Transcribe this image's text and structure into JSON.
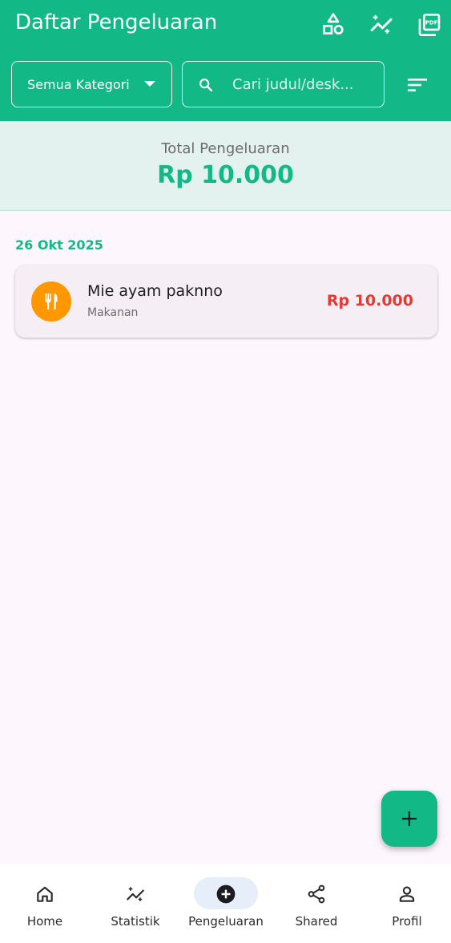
{
  "colors": {
    "primary": "#12b886",
    "expense_red": "#e53935",
    "category_food": "#ff9800",
    "background": "#fdf7fd"
  },
  "appbar": {
    "title": "Daftar Pengeluaran",
    "actions": [
      "category-shapes-icon",
      "auto-graph-icon",
      "pdf-export-icon"
    ]
  },
  "filter": {
    "selected": "Semua Kategori"
  },
  "search": {
    "placeholder": "Cari judul/desk..."
  },
  "summary": {
    "label": "Total Pengeluaran",
    "total": "Rp 10.000"
  },
  "groups": [
    {
      "date": "26 Okt 2025",
      "items": [
        {
          "title": "Mie ayam paknno",
          "category": "Makanan",
          "amount": "Rp 10.000",
          "icon": "restaurant-icon"
        }
      ]
    }
  ],
  "nav": {
    "items": [
      {
        "label": "Home",
        "icon": "home-icon"
      },
      {
        "label": "Statistik",
        "icon": "auto-graph-icon"
      },
      {
        "label": "Pengeluaran",
        "icon": "add-circle-icon",
        "active": true
      },
      {
        "label": "Shared",
        "icon": "share-icon"
      },
      {
        "label": "Profil",
        "icon": "person-icon"
      }
    ]
  }
}
